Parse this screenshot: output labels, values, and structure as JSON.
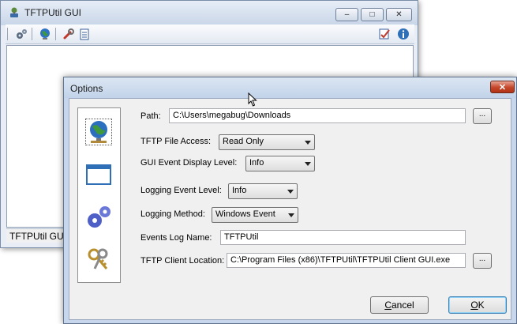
{
  "main_window": {
    "title": "TFTPUtil GUI",
    "caption_buttons": {
      "minimize": "–",
      "maximize": "□",
      "close": "✕"
    },
    "toolbar": {
      "icons": [
        "gears-icon",
        "globe-icon",
        "wrench-icon",
        "notepad-icon",
        "checklist-icon",
        "info-icon"
      ]
    },
    "status_text": "TFTPUtil GUI"
  },
  "options_dialog": {
    "title": "Options",
    "close_glyph": "✕",
    "categories": [
      "globe-network-icon",
      "window-icon",
      "gears-icon",
      "keys-icon"
    ],
    "path": {
      "label": "Path:",
      "value": "C:\\Users\\megabug\\Downloads",
      "browse_label": "..."
    },
    "file_access": {
      "label": "TFTP File Access:",
      "selected": "Read Only"
    },
    "gui_event_level": {
      "label": "GUI Event Display Level:",
      "selected": "Info"
    },
    "logging_event_level": {
      "label": "Logging Event Level:",
      "selected": "Info"
    },
    "logging_method": {
      "label": "Logging Method:",
      "selected": "Windows Event"
    },
    "events_log_name": {
      "label": "Events Log Name:",
      "value": "TFTPUtil"
    },
    "client_location": {
      "label": "TFTP Client Location:",
      "value": "C:\\Program Files (x86)\\TFTPUtil\\TFTPUtil Client GUI.exe",
      "browse_label": "..."
    },
    "cancel_first": "C",
    "cancel_rest": "ancel",
    "ok_first": "O",
    "ok_rest": "K"
  },
  "colors": {
    "accent": "#3c7fb1",
    "close_red": "#c4462a",
    "frame": "#c7d6ea"
  }
}
